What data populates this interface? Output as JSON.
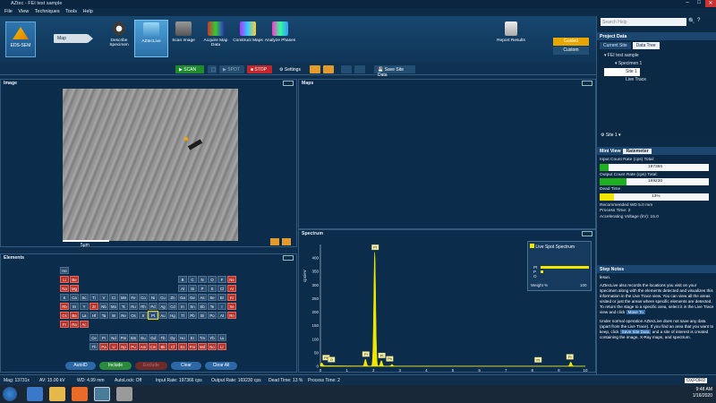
{
  "window": {
    "title": "AZtec - FEI test sample",
    "min": "–",
    "max": "□",
    "close": "✕"
  },
  "menu": [
    "File",
    "View",
    "Techniques",
    "Tools",
    "Help"
  ],
  "ribbon": {
    "eds_label": "EDS-SEM",
    "map_label": "Map",
    "buttons": [
      {
        "label": "Describe Specimen"
      },
      {
        "label": "AZtecLive"
      },
      {
        "label": "Scan Image"
      },
      {
        "label": "Acquire Map Data"
      },
      {
        "label": "Construct Maps"
      },
      {
        "label": "Analyze Phases"
      }
    ],
    "report_label": "Report Results",
    "guided": "Guided",
    "custom": "Custom"
  },
  "toolbar": {
    "scan": "SCAN",
    "spot": "SPOT",
    "stop": "STOP",
    "settings": "Settings",
    "save_site": "Save Site Data"
  },
  "image_panel": {
    "title": "Image",
    "scale": "5µm"
  },
  "maps_panel": {
    "title": "Maps"
  },
  "spectrum_panel": {
    "title": "Spectrum",
    "ylabel": "cps/eV",
    "xlabel": "keV",
    "live_spot": "Live Spot Spectrum",
    "weight_label": "Weight %",
    "weight_max": "100",
    "elements_short": [
      "Pt",
      "P",
      "O"
    ]
  },
  "elements_panel": {
    "title": "Elements",
    "autoid": "AutoID",
    "include": "Include",
    "exclude": "Exclude",
    "clear": "Clear",
    "clear_all": "Clear All"
  },
  "search": {
    "placeholder": "Search Help"
  },
  "project": {
    "title": "Project Data",
    "tabs": [
      "Current Site",
      "Data Tree"
    ],
    "tree": [
      "FEI test sample",
      "Specimen 1",
      "Site 1",
      "Live Trace"
    ],
    "site_select": "Site 1"
  },
  "miniview": {
    "title": "Mini View",
    "mode": "Ratemeter",
    "icr_label": "Input Count Rate (cps)",
    "icr_total_label": "Total:",
    "icr_value": "197366",
    "ocr_label": "Output Count Rate (cps)",
    "ocr_total_label": "Total:",
    "ocr_value": "169230",
    "dead_label": "Dead Time",
    "dead_value": "13%",
    "dead_fraction": 0.13,
    "recommended_wd": "Recommended WD 5.0 mm",
    "process_time": "Process Time: 2",
    "voltage": "Accelerating Voltage (kV): 15.0"
  },
  "stepnotes": {
    "title": "Step Notes",
    "frag": "lesun.",
    "p1": "AZtecLive also records the locations you visit on your specimen along with the elements detected and visualizes this information in the Live Trace view. You can view all the areas visited or just the areas where specific elements are detected. To return the stage to a specific area, select it in the Live Trace view and click",
    "p1_btn": "Move To",
    "p2": "Under normal operation AZtecLive does not save any data (apart from the Live Trace). If you find an area that you want to keep, click",
    "p2_btn": "Save Site Data",
    "p2b": "and a site of interest is created containing the image, X-Ray maps, and spectrum."
  },
  "status": {
    "mag": "Mag: 13731x",
    "av": "AV: 15.00 kV",
    "wd": "WD: 4.99 mm",
    "autolock": "AutoLock: Off",
    "input_rate": "Input Rate: 197366 cps",
    "output_rate": "Output Rate: 169230 cps",
    "dead_time": "Dead Time: 13 %",
    "process_time": "Process Time: 2",
    "brand": "OXFORD"
  },
  "taskbar": {
    "time": "9:48 AM",
    "date": "1/16/2020"
  },
  "colors": {
    "accent": "#4ea2d9",
    "spectrum": "#f2e600",
    "element_red": "#b8342a",
    "bar_green": "#1fb020"
  },
  "periodic_table": [
    [
      "He"
    ],
    [
      "Li",
      "Be",
      "",
      "",
      "",
      "",
      "",
      "",
      "",
      "",
      "",
      "",
      "B",
      "C",
      "N",
      "O",
      "F",
      "Ne"
    ],
    [
      "Na",
      "Mg",
      "",
      "",
      "",
      "",
      "",
      "",
      "",
      "",
      "",
      "",
      "Al",
      "Si",
      "P",
      "S",
      "Cl",
      "Ar"
    ],
    [
      "K",
      "Ca",
      "Sc",
      "Ti",
      "V",
      "Cr",
      "Mn",
      "Fe",
      "Co",
      "Ni",
      "Cu",
      "Zn",
      "Ga",
      "Ge",
      "As",
      "Se",
      "Br",
      "Kr"
    ],
    [
      "Rb",
      "Sr",
      "Y",
      "Zr",
      "Nb",
      "Mo",
      "Tc",
      "Ru",
      "Rh",
      "Pd",
      "Ag",
      "Cd",
      "In",
      "Sn",
      "Sb",
      "Te",
      "I",
      "Xe"
    ],
    [
      "Cs",
      "Ba",
      "La",
      "Hf",
      "Ta",
      "W",
      "Re",
      "Os",
      "Ir",
      "Pt",
      "Au",
      "Hg",
      "Tl",
      "Pb",
      "Bi",
      "Po",
      "At",
      "Rn"
    ],
    [
      "Fr",
      "Ra",
      "Ac"
    ],
    [
      "Ce",
      "Pr",
      "Nd",
      "Pm",
      "Sm",
      "Eu",
      "Gd",
      "Tb",
      "Dy",
      "Ho",
      "Er",
      "Tm",
      "Yb",
      "Lu"
    ],
    [
      "Th",
      "Pa",
      "U",
      "Np",
      "Pu",
      "Am",
      "Cm",
      "Bk",
      "Cf",
      "Es",
      "Fm",
      "Md",
      "No",
      "Lr"
    ]
  ],
  "chart_data": {
    "type": "line",
    "xlabel": "keV",
    "ylabel": "cps/eV",
    "xlim": [
      0,
      10
    ],
    "ylim": [
      0,
      450
    ],
    "x_ticks": [
      "0",
      "1",
      "2",
      "3",
      "4",
      "5",
      "6",
      "7",
      "8",
      "9",
      "10"
    ],
    "y_ticks": [
      "0",
      "50",
      "100",
      "150",
      "200",
      "250",
      "300",
      "350",
      "400"
    ],
    "peaks": [
      {
        "x": 0.05,
        "y": 10
      },
      {
        "x": 1.7,
        "y": 25
      },
      {
        "x": 2.05,
        "y": 420
      },
      {
        "x": 2.3,
        "y": 20
      },
      {
        "x": 2.7,
        "y": 6
      },
      {
        "x": 9.45,
        "y": 15
      }
    ],
    "annotations": [
      {
        "label": "Pt",
        "x": 2.05,
        "y": 420
      },
      {
        "label": "Pt",
        "x": 1.7,
        "y": 25
      },
      {
        "label": "Pt",
        "x": 2.3,
        "y": 20
      },
      {
        "label": "Pb",
        "x": 2.6,
        "y": 8
      },
      {
        "label": "Pb",
        "x": 0.2,
        "y": 12
      },
      {
        "label": "O",
        "x": 0.4,
        "y": 5
      },
      {
        "label": "Pt",
        "x": 9.4,
        "y": 15
      },
      {
        "label": "Pt",
        "x": 8.2,
        "y": 4
      }
    ]
  }
}
